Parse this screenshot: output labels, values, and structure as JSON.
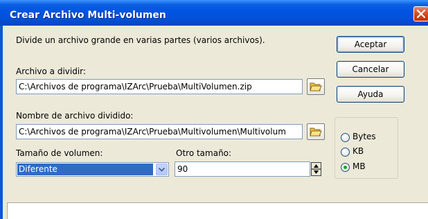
{
  "window": {
    "title": "Crear Archivo Multi-volumen"
  },
  "description": "Divide un archivo grande en varias partes (varios archivos).",
  "buttons": {
    "accept": "Aceptar",
    "cancel": "Cancelar",
    "help": "Ayuda"
  },
  "source": {
    "label": "Archivo a dividir:",
    "value": "C:\\Archivos de programa\\IZArc\\Prueba\\MultiVolumen.zip"
  },
  "output": {
    "label": "Nombre de archivo dividido:",
    "value": "C:\\Archivos de programa\\IZArc\\Prueba\\Multivolumen\\Multivolum"
  },
  "volume_size": {
    "label": "Tamaño de volumen:",
    "selected": "Diferente"
  },
  "other_size": {
    "label": "Otro tamaño:",
    "value": "90"
  },
  "units": {
    "options": [
      "Bytes",
      "KB",
      "MB"
    ],
    "selected": "MB"
  },
  "colors": {
    "titlebar": "#0054e3",
    "close_button": "#d2471d",
    "dialog_background": "#ece9d8",
    "selection": "#316ac5"
  },
  "icons": [
    "close-icon",
    "folder-open-icon",
    "chevron-down-icon",
    "spinner-icon"
  ]
}
